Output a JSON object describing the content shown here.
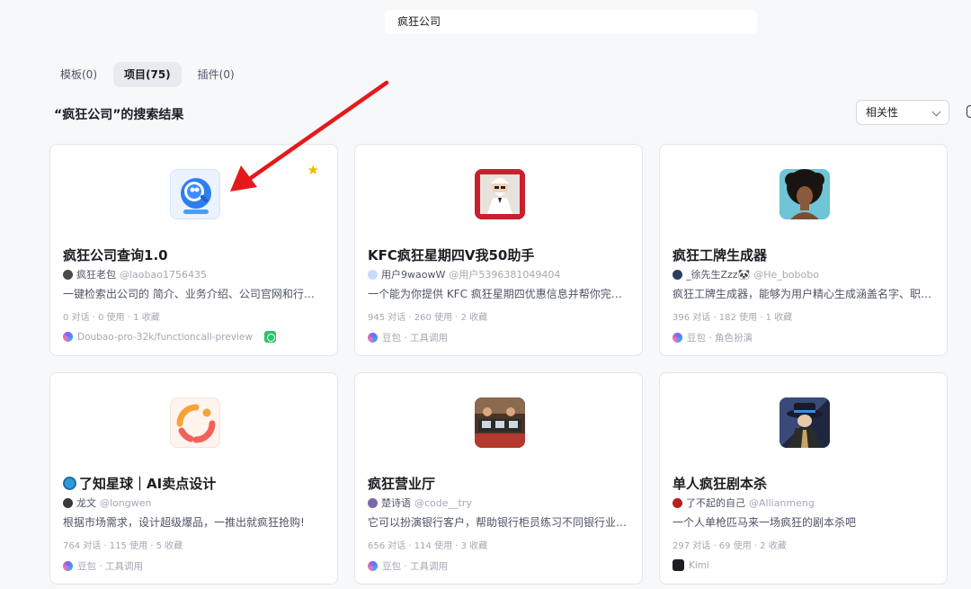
{
  "search": {
    "value": "疯狂公司"
  },
  "tabs": [
    {
      "label": "模板(0)",
      "active": false
    },
    {
      "label": "项目(75)",
      "active": true
    },
    {
      "label": "插件(0)",
      "active": false
    }
  ],
  "results_title": "“疯狂公司”的搜索结果",
  "sort": {
    "selected": "相关性"
  },
  "cards": [
    {
      "title": "疯狂公司查询1.0",
      "author": "疯狂老包",
      "handle": "@laobao1756435",
      "desc": "一键检索出公司的 简介、业务介绍、公司官网和行…",
      "stats": "0 对话 · 0 使用 · 1 收藏",
      "model": "Doubao-pro-32k/functioncall-preview",
      "starred": true,
      "thumb_icon": "magnifier-search-icon",
      "colors": {
        "thumb": "#2f7ef0"
      }
    },
    {
      "title": "KFC疯狂星期四V我50助手",
      "author": "用户9waowW",
      "handle": "@用户5396381049404",
      "desc": "一个能为你提供 KFC 疯狂星期四优惠信息并帮你完…",
      "stats": "945 对话 · 260 使用 · 2 收藏",
      "model": "豆包 · 工具调用",
      "thumb_icon": "colonel-portrait-icon",
      "colors": {
        "thumb": "#c8202d"
      }
    },
    {
      "title": "疯狂工牌生成器",
      "author": "_徐先生Zzz🐼",
      "handle": "@He_bobobo",
      "desc": "疯狂工牌生成器，能够为用户精心生成涵盖名字、职…",
      "stats": "396 对话 · 182 使用 · 1 收藏",
      "model": "豆包 · 角色扮演",
      "thumb_icon": "afro-portrait-icon",
      "colors": {
        "thumb": "#6fc4d6"
      }
    },
    {
      "title": "了知星球｜AI卖点设计",
      "author": "龙文",
      "handle": "@longwen",
      "desc": "根据市场需求，设计超级爆品，一推出就疯狂抢购!",
      "stats": "764 对话 · 115 使用 · 5 收藏",
      "model": "豆包 · 工具调用",
      "thumb_icon": "orange-ring-logo-icon",
      "colors": {
        "thumb": "#f26b4b"
      }
    },
    {
      "title": "疯狂营业厅",
      "author": "楚诗语",
      "handle": "@code__try",
      "desc": "它可以扮演银行客户，帮助银行柜员练习不同银行业…",
      "stats": "656 对话 · 114 使用 · 3 收藏",
      "model": "豆包 · 工具调用",
      "thumb_icon": "office-scene-icon",
      "colors": {
        "thumb": "#6b4b3a"
      }
    },
    {
      "title": "单人疯狂剧本杀",
      "author": "了不起的自己",
      "handle": "@Allianmeng",
      "desc": "一个人单枪匹马来一场疯狂的剧本杀吧",
      "stats": "297 对话 · 69 使用 · 2 收藏",
      "model": "Kimi",
      "thumb_icon": "detective-hat-icon",
      "colors": {
        "thumb": "#2a3a66"
      }
    }
  ],
  "annotation": {
    "color": "#e5191c"
  }
}
